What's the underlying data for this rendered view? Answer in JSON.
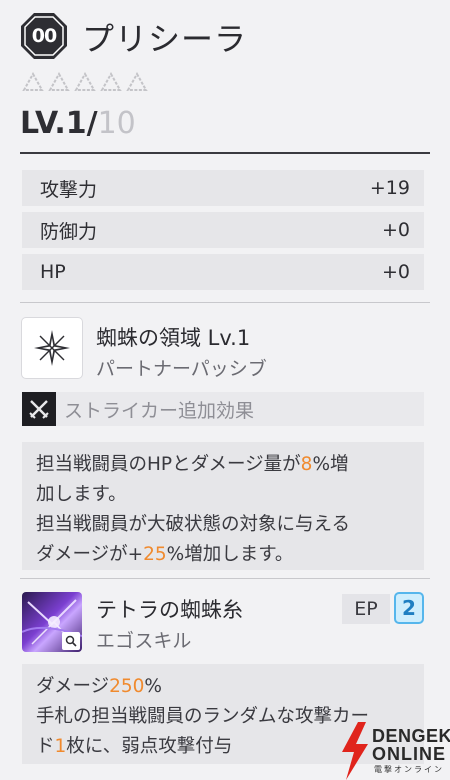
{
  "header": {
    "badge_text": "00",
    "character_name": "プリシーラ",
    "stars_total": 5,
    "stars_filled": 0,
    "level_current": "LV.1/",
    "level_max": "10"
  },
  "stats": [
    {
      "label": "攻撃力",
      "value": "+19"
    },
    {
      "label": "防御力",
      "value": "+0"
    },
    {
      "label": "HP",
      "value": "+0"
    }
  ],
  "passive": {
    "icon": "sparkle-icon",
    "title": "蜘蛛の領域 Lv.1",
    "subtitle": "パートナーパッシブ",
    "striker_label": "ストライカー追加効果",
    "desc_line1_a": "担当戦闘員のHPとダメージ量が",
    "desc_line1_b": "8",
    "desc_line1_c": "%増",
    "desc_line2": "加します。",
    "desc_line3": "担当戦闘員が大破状態の対象に与える",
    "desc_line4_a": "ダメージが+",
    "desc_line4_b": "25",
    "desc_line4_c": "%増加します。"
  },
  "ego": {
    "icon": "ego-portrait-icon",
    "title": "テトラの蜘蛛糸",
    "subtitle": "エゴスキル",
    "ep_label": "EP",
    "ep_value": "2",
    "desc_line1_a": "ダメージ",
    "desc_line1_b": "250",
    "desc_line1_c": "%",
    "desc_line2": "手札の担当戦闘員のランダムな攻撃カー",
    "desc_line3_a": "ド",
    "desc_line3_b": "1",
    "desc_line3_c": "枚に、弱点攻撃付与"
  },
  "watermark": {
    "line1": "DENGEKI",
    "line2": "ONLINE",
    "line3": "電撃オンライン"
  },
  "colors": {
    "accent_orange": "#f08a2e",
    "ep_blue": "#56b6ec",
    "panel_gray": "#e6e6e9"
  }
}
